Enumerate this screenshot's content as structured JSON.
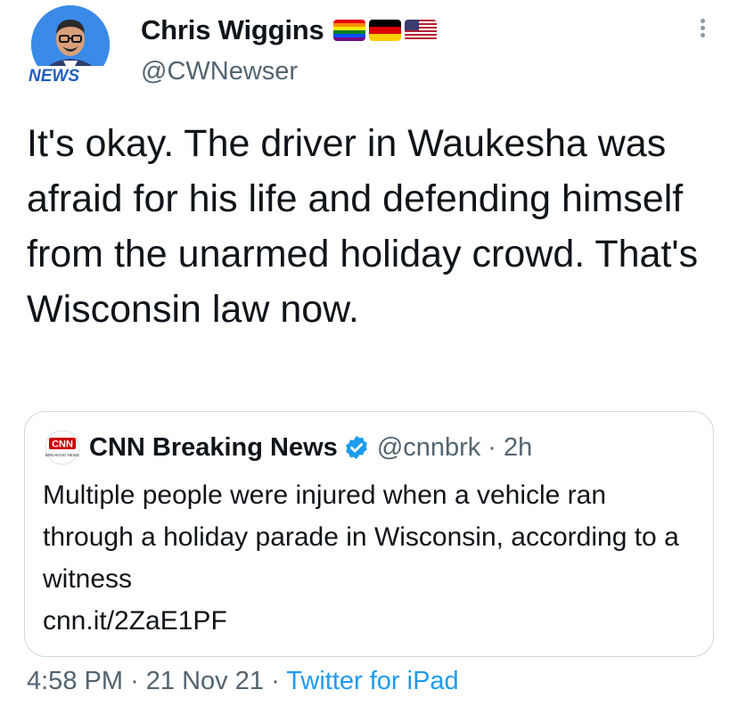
{
  "author": {
    "name": "Chris Wiggins",
    "handle": "@CWNewser",
    "avatar_badge": "NEWS",
    "flags": [
      "rainbow-flag",
      "germany-flag",
      "usa-flag"
    ]
  },
  "tweet": {
    "text": "It's okay. The driver in Waukesha was afraid for his life and defending himself from the unarmed holiday crowd. That's Wisconsin law now."
  },
  "quoted": {
    "name": "CNN Breaking News",
    "handle": "@cnnbrk",
    "separator": "·",
    "age": "2h",
    "logo_text": "CNN",
    "logo_sub": "BREAKING NEWS",
    "text": "Multiple people were injured when a vehicle ran through a holiday parade in Wisconsin, according to a witness",
    "link": "cnn.it/2ZaE1PF"
  },
  "footer": {
    "time": "4:58 PM",
    "sep1": "·",
    "date": "21 Nov 21",
    "sep2": "·",
    "source": "Twitter for iPad"
  },
  "colors": {
    "text": "#0f1419",
    "secondary": "#536471",
    "link": "#1d9bf0",
    "verified": "#1d9bf0",
    "border": "#cfd9de",
    "cnn_red": "#cc0000"
  },
  "icons": [
    "avatar",
    "rainbow-flag",
    "germany-flag",
    "usa-flag",
    "more-icon",
    "cnn-logo",
    "verified-icon"
  ]
}
